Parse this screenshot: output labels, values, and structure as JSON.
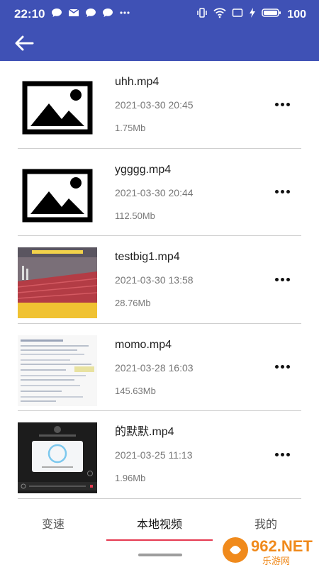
{
  "status_bar": {
    "time": "22:10",
    "battery_level": "100"
  },
  "app_bar": {
    "back_icon": "arrow-left-icon"
  },
  "videos": [
    {
      "name": "uhh.mp4",
      "date": "2021-03-30 20:45",
      "size": "1.75Mb",
      "thumbnail": "image-placeholder"
    },
    {
      "name": "ygggg.mp4",
      "date": "2021-03-30 20:44",
      "size": "112.50Mb",
      "thumbnail": "image-placeholder"
    },
    {
      "name": "testbig1.mp4",
      "date": "2021-03-30 13:58",
      "size": "28.76Mb",
      "thumbnail": "video-frame"
    },
    {
      "name": "momo.mp4",
      "date": "2021-03-28 16:03",
      "size": "145.63Mb",
      "thumbnail": "video-frame"
    },
    {
      "name": "的默默.mp4",
      "date": "2021-03-25 11:13",
      "size": "1.96Mb",
      "thumbnail": "video-frame"
    }
  ],
  "tabs": [
    {
      "label": "变速",
      "active": false
    },
    {
      "label": "本地视频",
      "active": true
    },
    {
      "label": "我的",
      "active": false
    }
  ],
  "watermark": {
    "text": "962.NET",
    "subtext": "乐游网"
  },
  "colors": {
    "app_bar": "#3f51b5",
    "tab_indicator": "#e53950",
    "divider": "#cfcfcf"
  }
}
